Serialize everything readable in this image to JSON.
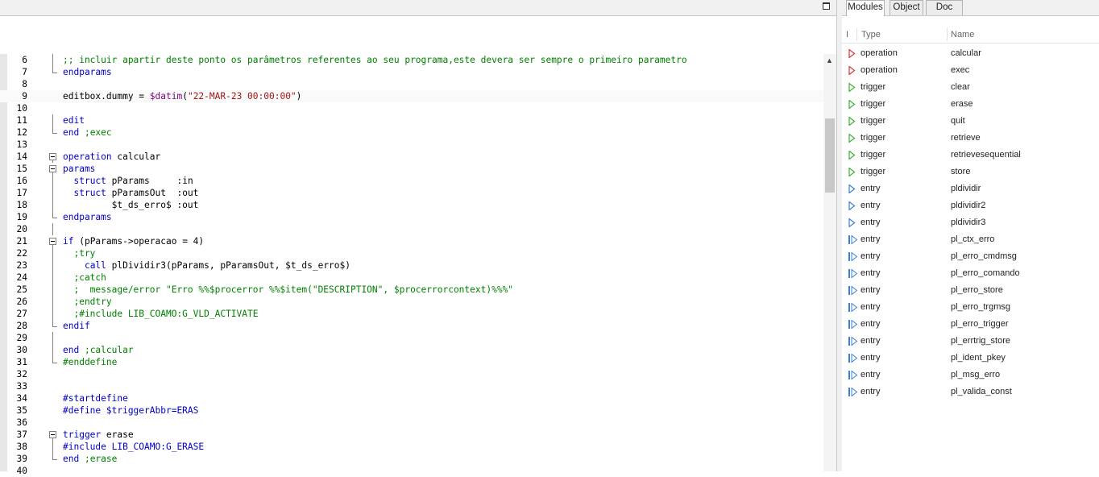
{
  "editor": {
    "lines": [
      {
        "n": "6",
        "fold": "line",
        "parts": [
          [
            "cm",
            ";; incluir apartir deste ponto os parâmetros referentes ao seu programa,este devera ser sempre o primeiro parametro"
          ]
        ]
      },
      {
        "n": "7",
        "fold": "end",
        "parts": [
          [
            "kw",
            "endparams"
          ]
        ]
      },
      {
        "n": "8",
        "fold": "",
        "parts": []
      },
      {
        "n": "9",
        "fold": "",
        "cur": true,
        "parts": [
          [
            "",
            "editbox.dummy = "
          ],
          [
            "sys",
            "$datim"
          ],
          [
            "",
            "("
          ],
          [
            "str",
            "\"22-MAR-23 00:00:00\""
          ],
          [
            "",
            ")"
          ]
        ]
      },
      {
        "n": "10",
        "fold": "",
        "parts": []
      },
      {
        "n": "11",
        "fold": "line",
        "parts": [
          [
            "kw",
            "edit"
          ]
        ]
      },
      {
        "n": "12",
        "fold": "end",
        "parts": [
          [
            "kw",
            "end"
          ],
          [
            "cm",
            " ;exec"
          ]
        ]
      },
      {
        "n": "13",
        "fold": "",
        "parts": []
      },
      {
        "n": "14",
        "fold": "box",
        "parts": [
          [
            "kw",
            "operation"
          ],
          [
            "",
            " calcular"
          ]
        ]
      },
      {
        "n": "15",
        "fold": "box",
        "parts": [
          [
            "kw",
            "params"
          ]
        ]
      },
      {
        "n": "16",
        "fold": "line",
        "parts": [
          [
            "",
            "  "
          ],
          [
            "kw",
            "struct"
          ],
          [
            "",
            " pParams     :in"
          ]
        ]
      },
      {
        "n": "17",
        "fold": "line",
        "parts": [
          [
            "",
            "  "
          ],
          [
            "kw",
            "struct"
          ],
          [
            "",
            " pParamsOut  :out"
          ]
        ]
      },
      {
        "n": "18",
        "fold": "line",
        "parts": [
          [
            "",
            "         $t_ds_erro$ :out"
          ]
        ]
      },
      {
        "n": "19",
        "fold": "end",
        "parts": [
          [
            "kw",
            "endparams"
          ]
        ]
      },
      {
        "n": "20",
        "fold": "line",
        "parts": []
      },
      {
        "n": "21",
        "fold": "box",
        "parts": [
          [
            "kw",
            "if"
          ],
          [
            "",
            " (pParams->operacao = 4)"
          ]
        ]
      },
      {
        "n": "22",
        "fold": "line",
        "parts": [
          [
            "cm",
            "  ;try"
          ]
        ]
      },
      {
        "n": "23",
        "fold": "line",
        "parts": [
          [
            "",
            "    "
          ],
          [
            "kw",
            "call"
          ],
          [
            "",
            " plDividir3(pParams, pParamsOut, $t_ds_erro$)"
          ]
        ]
      },
      {
        "n": "24",
        "fold": "line",
        "parts": [
          [
            "cm",
            "  ;catch"
          ]
        ]
      },
      {
        "n": "25",
        "fold": "line",
        "parts": [
          [
            "cm",
            "  ;  message/error \"Erro %%$procerror %%$item(\"DESCRIPTION\", $procerrorcontext)%%%\""
          ]
        ]
      },
      {
        "n": "26",
        "fold": "line",
        "parts": [
          [
            "cm",
            "  ;endtry"
          ]
        ]
      },
      {
        "n": "27",
        "fold": "line",
        "parts": [
          [
            "cm",
            "  ;#include LIB_COAMO:G_VLD_ACTIVATE"
          ]
        ]
      },
      {
        "n": "28",
        "fold": "end",
        "parts": [
          [
            "kw",
            "endif"
          ]
        ]
      },
      {
        "n": "29",
        "fold": "line",
        "parts": []
      },
      {
        "n": "30",
        "fold": "line",
        "parts": [
          [
            "kw",
            "end"
          ],
          [
            "cm",
            " ;calcular"
          ]
        ]
      },
      {
        "n": "31",
        "fold": "end",
        "parts": [
          [
            "cm",
            "#enddefine"
          ]
        ]
      },
      {
        "n": "32",
        "fold": "",
        "parts": []
      },
      {
        "n": "33",
        "fold": "",
        "parts": []
      },
      {
        "n": "34",
        "fold": "",
        "parts": [
          [
            "kw",
            "#startdefine"
          ]
        ]
      },
      {
        "n": "35",
        "fold": "",
        "parts": [
          [
            "kw",
            "#define $triggerAbbr=ERAS"
          ]
        ]
      },
      {
        "n": "36",
        "fold": "",
        "parts": []
      },
      {
        "n": "37",
        "fold": "box",
        "parts": [
          [
            "kw",
            "trigger"
          ],
          [
            "",
            " erase"
          ]
        ]
      },
      {
        "n": "38",
        "fold": "line",
        "parts": [
          [
            "kw",
            "#include LIB_COAMO:G_ERASE"
          ]
        ]
      },
      {
        "n": "39",
        "fold": "end",
        "parts": [
          [
            "kw",
            "end"
          ],
          [
            "cm",
            " ;erase"
          ]
        ]
      },
      {
        "n": "40",
        "fold": "",
        "parts": []
      }
    ]
  },
  "panel": {
    "tabs": [
      "Modules",
      "Object",
      "Doc"
    ],
    "active_tab": "Modules",
    "columns": {
      "indicator": "I",
      "type": "Type",
      "name": "Name"
    },
    "rows": [
      {
        "type": "operation",
        "name": "calcular",
        "icon": "red"
      },
      {
        "type": "operation",
        "name": "exec",
        "icon": "red"
      },
      {
        "type": "trigger",
        "name": "clear",
        "icon": "green"
      },
      {
        "type": "trigger",
        "name": "erase",
        "icon": "green"
      },
      {
        "type": "trigger",
        "name": "quit",
        "icon": "green"
      },
      {
        "type": "trigger",
        "name": "retrieve",
        "icon": "green"
      },
      {
        "type": "trigger",
        "name": "retrievesequential",
        "icon": "green"
      },
      {
        "type": "trigger",
        "name": "store",
        "icon": "green"
      },
      {
        "type": "entry",
        "name": "pldividir",
        "icon": "blue"
      },
      {
        "type": "entry",
        "name": "pldividir2",
        "icon": "blue"
      },
      {
        "type": "entry",
        "name": "pldividir3",
        "icon": "blue"
      },
      {
        "type": "entry",
        "name": "pl_ctx_erro",
        "icon": "blue-ext"
      },
      {
        "type": "entry",
        "name": "pl_erro_cmdmsg",
        "icon": "blue-ext"
      },
      {
        "type": "entry",
        "name": "pl_erro_comando",
        "icon": "blue-ext"
      },
      {
        "type": "entry",
        "name": "pl_erro_store",
        "icon": "blue-ext"
      },
      {
        "type": "entry",
        "name": "pl_erro_trgmsg",
        "icon": "blue-ext"
      },
      {
        "type": "entry",
        "name": "pl_erro_trigger",
        "icon": "blue-ext"
      },
      {
        "type": "entry",
        "name": "pl_errtrig_store",
        "icon": "blue-ext"
      },
      {
        "type": "entry",
        "name": "pl_ident_pkey",
        "icon": "blue-ext"
      },
      {
        "type": "entry",
        "name": "pl_msg_erro",
        "icon": "blue-ext"
      },
      {
        "type": "entry",
        "name": "pl_valida_const",
        "icon": "blue-ext"
      }
    ],
    "icon_colors": {
      "red": "#d9363e",
      "green": "#3fae3a",
      "blue": "#3d7fd0"
    }
  }
}
